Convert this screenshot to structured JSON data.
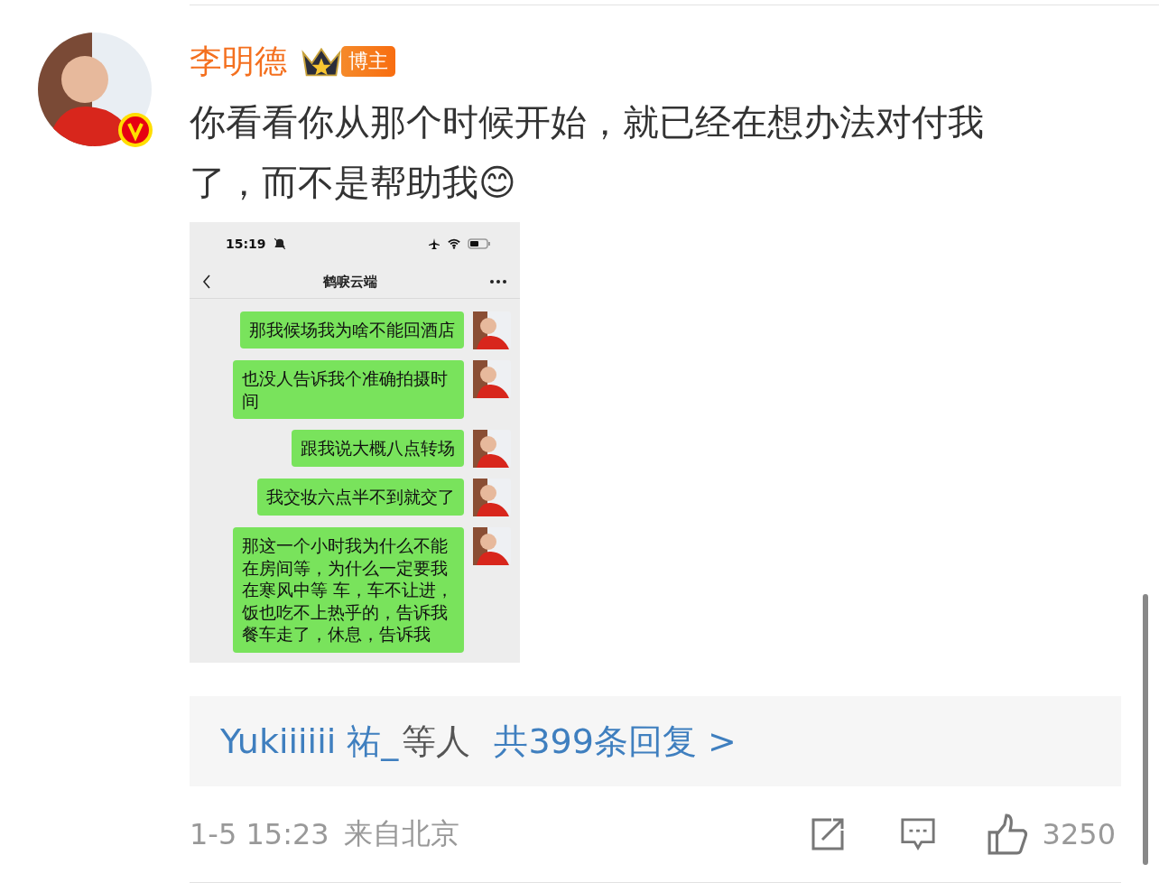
{
  "comment": {
    "author": "李明德",
    "badge": "博主",
    "verified": true,
    "text": "你看看你从那个时候开始，就已经在想办法对付我了，而不是帮助我😊",
    "screenshot": {
      "time": "15:19",
      "title": "鹤唳云端",
      "messages": [
        {
          "text": "那我候场我为啥不能回酒店"
        },
        {
          "text": "也没人告诉我个准确拍摄时间"
        },
        {
          "text": "跟我说大概八点转场"
        },
        {
          "text": "我交妆六点半不到就交了"
        },
        {
          "text": "那这一个小时我为什么不能在房间等，为什么一定要我在寒风中等 车，车不让进，饭也吃不上热乎的，告诉我餐车走了，休息，告诉我"
        }
      ]
    },
    "replies": {
      "names": "Yukiiiiii 祐_",
      "suffix": "等人",
      "link": "共399条回复 >"
    },
    "footer": {
      "time": "1-5 15:23",
      "source": "来自北京",
      "likes": "3250"
    }
  }
}
